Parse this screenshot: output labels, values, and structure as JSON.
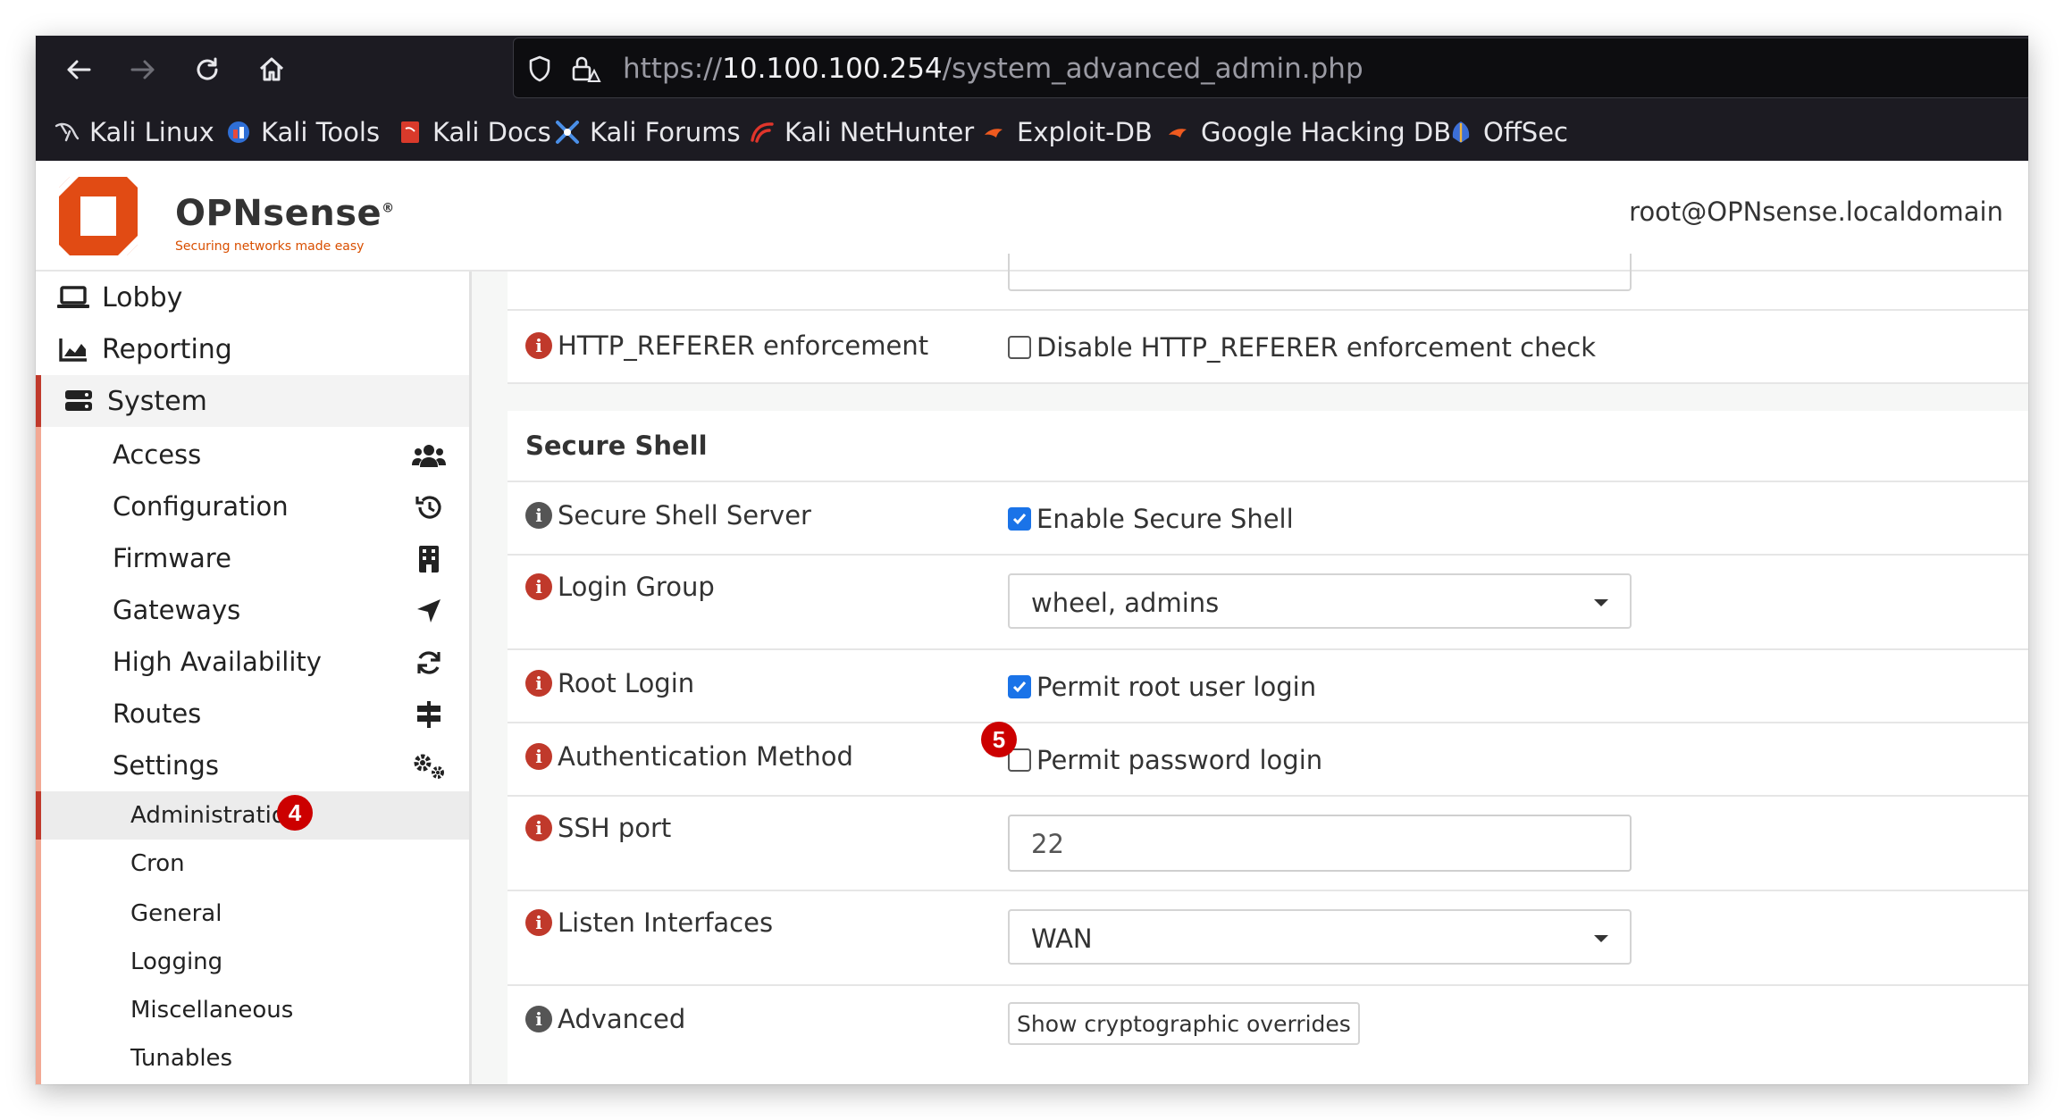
{
  "browser": {
    "url_scheme": "https://",
    "url_host": "10.100.100.254",
    "url_path": "/system_advanced_admin.php",
    "bookmarks": [
      {
        "label": "Kali Linux",
        "icon": "kali-dragon-icon"
      },
      {
        "label": "Kali Tools",
        "icon": "kali-tools-icon"
      },
      {
        "label": "Kali Docs",
        "icon": "kali-docs-icon"
      },
      {
        "label": "Kali Forums",
        "icon": "kali-forums-icon"
      },
      {
        "label": "Kali NetHunter",
        "icon": "kali-nethunter-icon"
      },
      {
        "label": "Exploit-DB",
        "icon": "exploit-db-icon"
      },
      {
        "label": "Google Hacking DB",
        "icon": "ghdb-icon"
      },
      {
        "label": "OffSec",
        "icon": "offsec-icon"
      }
    ]
  },
  "header": {
    "brand": "OPNsense",
    "tagline": "Securing networks made easy",
    "user": "root@OPNsense.localdomain",
    "accent_color": "#d94f00"
  },
  "sidebar": {
    "top_items": [
      {
        "label": "Lobby",
        "icon": "laptop-icon"
      },
      {
        "label": "Reporting",
        "icon": "area-chart-icon"
      },
      {
        "label": "System",
        "icon": "server-icon"
      }
    ],
    "system_items": [
      {
        "label": "Access",
        "icon": "users-icon"
      },
      {
        "label": "Configuration",
        "icon": "history-icon"
      },
      {
        "label": "Firmware",
        "icon": "building-icon"
      },
      {
        "label": "Gateways",
        "icon": "location-arrow-icon"
      },
      {
        "label": "High Availability",
        "icon": "refresh-icon"
      },
      {
        "label": "Routes",
        "icon": "signpost-icon"
      },
      {
        "label": "Settings",
        "icon": "cogs-icon"
      }
    ],
    "settings_items": [
      "Administration",
      "Cron",
      "General",
      "Logging",
      "Miscellaneous",
      "Tunables"
    ],
    "active_item": "Administration",
    "step_badge": "4"
  },
  "content": {
    "referer": {
      "label": "HTTP_REFERER enforcement",
      "checkbox_label": "Disable HTTP_REFERER enforcement check",
      "checked": false
    },
    "ssh_section_title": "Secure Shell",
    "ssh_server": {
      "label": "Secure Shell Server",
      "checkbox_label": "Enable Secure Shell",
      "checked": true
    },
    "login_group": {
      "label": "Login Group",
      "value": "wheel, admins"
    },
    "root_login": {
      "label": "Root Login",
      "checkbox_label": "Permit root user login",
      "checked": true
    },
    "auth_method": {
      "label": "Authentication Method",
      "checkbox_label": "Permit password login",
      "checked": false,
      "step_badge": "5"
    },
    "ssh_port": {
      "label": "SSH port",
      "placeholder": "22"
    },
    "listen_interfaces": {
      "label": "Listen Interfaces",
      "value": "WAN"
    },
    "advanced": {
      "label": "Advanced",
      "button_label": "Show cryptographic overrides"
    }
  }
}
